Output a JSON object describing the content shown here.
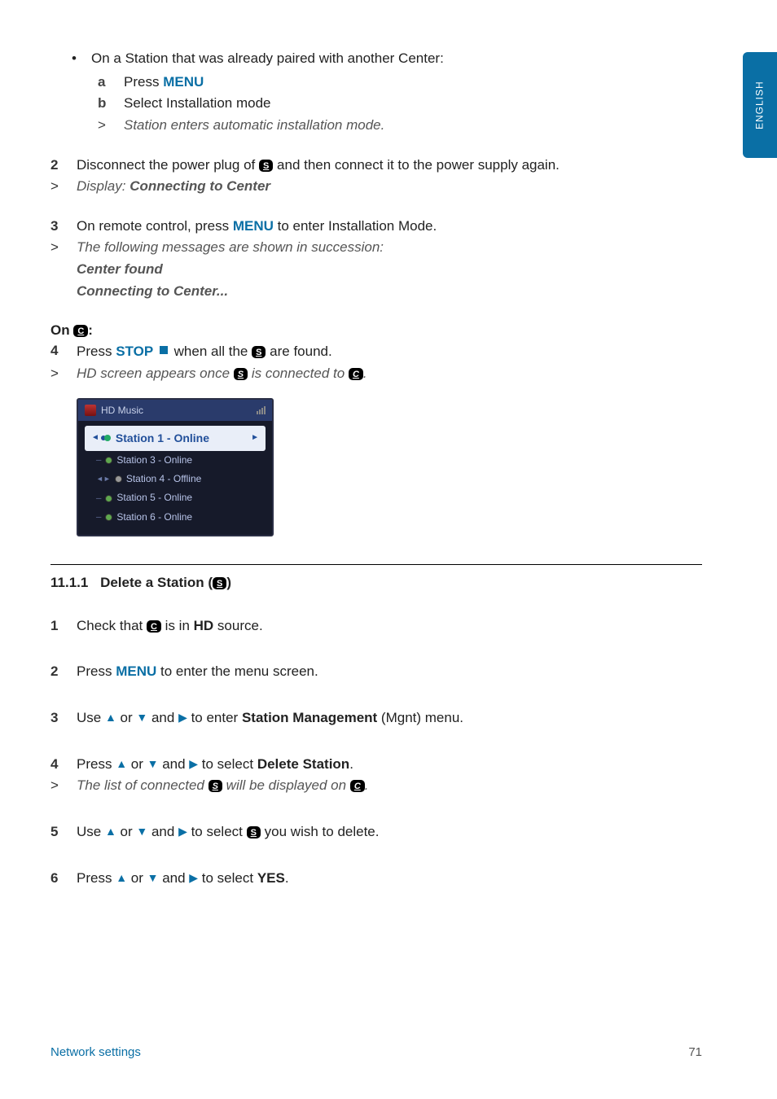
{
  "lang_tab": "ENGLISH",
  "intro": {
    "bullet": "On a Station that was already paired with another Center:",
    "a_label": "a",
    "a_text_pre": "Press ",
    "a_action": "MENU",
    "b_label": "b",
    "b_text": "Select Installation mode",
    "res_gt": ">",
    "res_text": "Station enters automatic installation mode."
  },
  "step2": {
    "num": "2",
    "pre": "Disconnect the power plug of ",
    "icon": "S",
    "post": " and then connect it to the power supply again.",
    "gt": ">",
    "res_pre": "Display: ",
    "res_bold": "Connecting to Center"
  },
  "step3": {
    "num": "3",
    "pre": "On remote control, press ",
    "action": "MENU",
    "post": " to enter Installation Mode.",
    "gt": ">",
    "res1": "The following messages are shown in succession:",
    "res2": "Center found",
    "res3": "Connecting to Center..."
  },
  "on_c": {
    "pre": "On ",
    "icon": "C",
    "colon": ":"
  },
  "step4": {
    "num": "4",
    "pre": "Press ",
    "action": "STOP",
    "mid": " when all the ",
    "icon": "S",
    "post": " are found.",
    "gt": ">",
    "res_pre": "HD screen appears once ",
    "res_icon1": "S",
    "res_mid": " is connected to ",
    "res_icon2": "C",
    "res_end": "."
  },
  "osd": {
    "header": "HD Music",
    "selected": "Station 1 - Online",
    "items": [
      {
        "label": "Station 3 - Online",
        "state": "on"
      },
      {
        "label": "Station 4 - Offline",
        "state": "off"
      },
      {
        "label": "Station 5 - Online",
        "state": "on"
      },
      {
        "label": "Station 6 - Online",
        "state": "on"
      }
    ]
  },
  "section": {
    "num": "11.1.1",
    "title_pre": "Delete a Station (",
    "icon": "S",
    "title_post": ")"
  },
  "d1": {
    "num": "1",
    "pre": "Check that ",
    "icon": "C",
    "mid": " is in ",
    "bold": "HD",
    "post": " source."
  },
  "d2": {
    "num": "2",
    "pre": "Press ",
    "action": "MENU",
    "post": " to enter the menu screen."
  },
  "d3": {
    "num": "3",
    "pre": "Use ",
    "mid1": " or ",
    "mid2": " and ",
    "mid3": " to enter ",
    "bold": "Station Management",
    "post": " (Mgnt) menu."
  },
  "d4": {
    "num": "4",
    "pre": "Press ",
    "mid1": " or ",
    "mid2": " and ",
    "mid3": " to select ",
    "bold": "Delete Station",
    "post": ".",
    "gt": ">",
    "res_pre": "The list of connected ",
    "icon1": "S",
    "res_mid": " will be displayed on ",
    "icon2": "C",
    "res_end": "."
  },
  "d5": {
    "num": "5",
    "pre": "Use ",
    "mid1": " or ",
    "mid2": " and ",
    "mid3": " to select ",
    "icon": "S",
    "post": " you wish to delete."
  },
  "d6": {
    "num": "6",
    "pre": "Press ",
    "mid1": " or ",
    "mid2": " and ",
    "mid3": " to select ",
    "bold": "YES",
    "post": "."
  },
  "footer": {
    "left": "Network settings",
    "right": "71"
  }
}
